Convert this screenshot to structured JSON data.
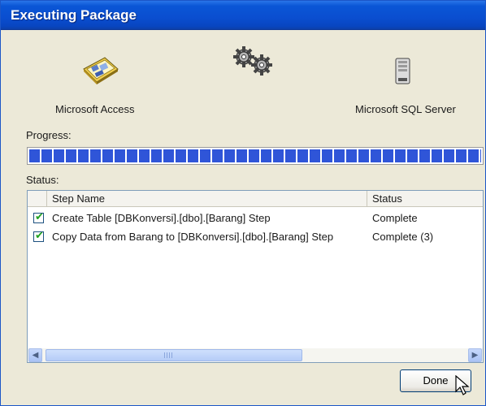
{
  "window": {
    "title": "Executing Package"
  },
  "sources": {
    "left_label": "Microsoft Access",
    "right_label": "Microsoft SQL Server",
    "left_icon": "access-database-icon",
    "middle_icon": "gears-icon",
    "right_icon": "sql-server-icon"
  },
  "progress": {
    "label": "Progress:",
    "fraction": 1.0
  },
  "status": {
    "label": "Status:",
    "columns": [
      "Step Name",
      "Status"
    ],
    "rows": [
      {
        "checked": true,
        "step": "Create Table [DBKonversi].[dbo].[Barang] Step",
        "status": "Complete"
      },
      {
        "checked": true,
        "step": "Copy Data from Barang to [DBKonversi].[dbo].[Barang] Step",
        "status": "Complete (3)"
      }
    ]
  },
  "footer": {
    "done_label": "Done"
  },
  "colors": {
    "title_bar": "#0a4ed0",
    "progress": "#2f55d8",
    "dialog_bg": "#ece9d8"
  }
}
